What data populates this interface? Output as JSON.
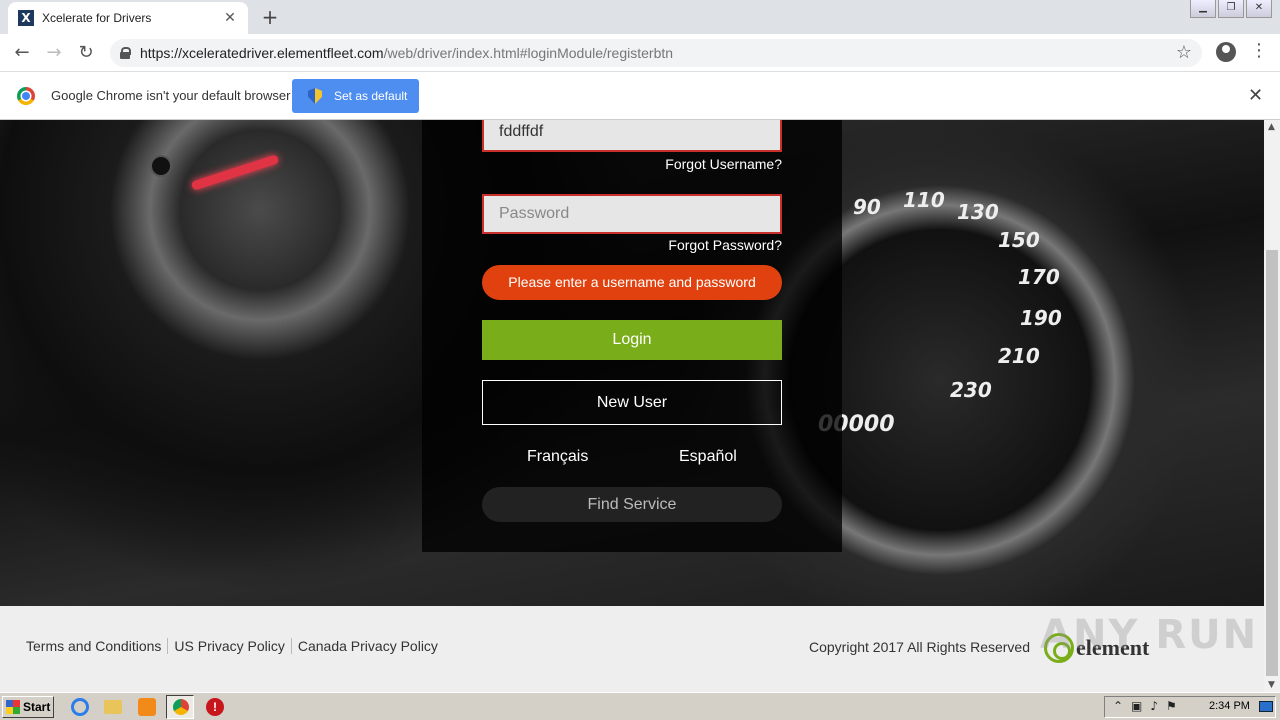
{
  "browser": {
    "tab_title": "Xcelerate for Drivers",
    "tab_favicon": "X",
    "url_host": "https://xceleratedriver.elementfleet.com",
    "url_path": "/web/driver/index.html#loginModule/registerbtn"
  },
  "infobar": {
    "message": "Google Chrome isn't your default browser",
    "button_label": "Set as default"
  },
  "login": {
    "username_value": "fddffdf",
    "password_placeholder": "Password",
    "forgot_username": "Forgot Username?",
    "forgot_password": "Forgot Password?",
    "error_message": "Please enter a username and password",
    "login_label": "Login",
    "new_user_label": "New User",
    "lang_fr": "Français",
    "lang_es": "Español",
    "find_service_label": "Find Service"
  },
  "gauge": {
    "numbers": [
      "90",
      "110",
      "130",
      "150",
      "170",
      "190",
      "210",
      "230"
    ],
    "odometer": "00000"
  },
  "footer": {
    "links": [
      "Terms and Conditions",
      "US Privacy Policy",
      "Canada Privacy Policy"
    ],
    "copyright": "Copyright 2017 All Rights Reserved",
    "logo_text": "element"
  },
  "taskbar": {
    "start_label": "Start",
    "clock": "2:34 PM"
  },
  "watermark": "ANY RUN",
  "colors": {
    "login_green": "#7aad1a",
    "error_orange": "#e1410f",
    "set_default_blue": "#4d8ef0"
  }
}
